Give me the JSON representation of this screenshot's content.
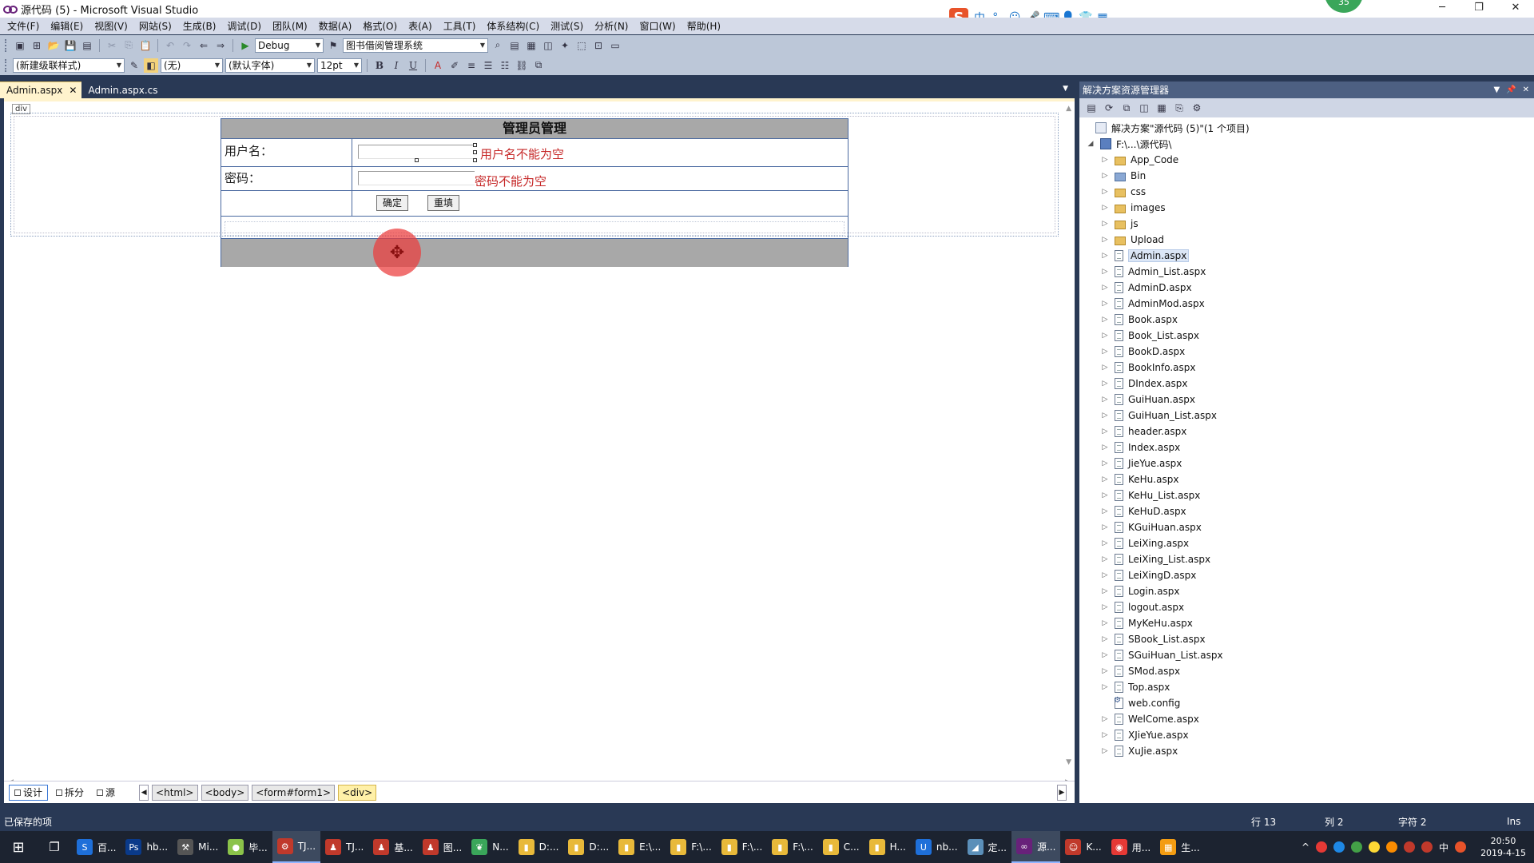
{
  "window": {
    "title": "源代码 (5) - Microsoft Visual Studio",
    "controls": [
      "─",
      "❐",
      "✕"
    ]
  },
  "ime": {
    "logo": "S",
    "items": [
      "中",
      "°,",
      "☺",
      "🎤",
      "⌨",
      "👤",
      "👕",
      "▦"
    ],
    "badge": "35"
  },
  "menu": [
    "文件(F)",
    "编辑(E)",
    "视图(V)",
    "网站(S)",
    "生成(B)",
    "调试(D)",
    "团队(M)",
    "数据(A)",
    "格式(O)",
    "表(A)",
    "工具(T)",
    "体系结构(C)",
    "测试(S)",
    "分析(N)",
    "窗口(W)",
    "帮助(H)"
  ],
  "toolbar1": {
    "config": "Debug",
    "project": "图书借阅管理系统"
  },
  "toolbar2": {
    "style": "(新建级联样式)",
    "block": "(无)",
    "font": "(默认字体)",
    "size": "12pt",
    "bold": "B",
    "italic": "I",
    "underline": "U"
  },
  "tabs": [
    {
      "label": "Admin.aspx",
      "close": "✕"
    },
    {
      "label": "Admin.aspx.cs"
    }
  ],
  "design": {
    "div_tag": "div",
    "table_title": "管理员管理",
    "username_label": "用户名：",
    "password_label": "密码：",
    "username_error": "用户名不能为空",
    "password_error": "密码不能为空",
    "ok_button": "确定",
    "reset_button": "重填",
    "move_glyph": "✥"
  },
  "views": [
    {
      "label": "设计"
    },
    {
      "label": "拆分"
    },
    {
      "label": "源"
    }
  ],
  "breadcrumb": [
    "<html>",
    "<body>",
    "<form#form1>",
    "<div>"
  ],
  "solution_explorer": {
    "title": "解决方案资源管理器",
    "solution": "解决方案\"源代码 (5)\"(1 个项目)",
    "project": "F:\\...\\源代码\\",
    "items": [
      {
        "name": "App_Code",
        "type": "folder"
      },
      {
        "name": "Bin",
        "type": "bin"
      },
      {
        "name": "css",
        "type": "folder"
      },
      {
        "name": "images",
        "type": "folder"
      },
      {
        "name": "js",
        "type": "folder"
      },
      {
        "name": "Upload",
        "type": "folder"
      },
      {
        "name": "Admin.aspx",
        "type": "file"
      },
      {
        "name": "Admin_List.aspx",
        "type": "file"
      },
      {
        "name": "AdminD.aspx",
        "type": "file"
      },
      {
        "name": "AdminMod.aspx",
        "type": "file"
      },
      {
        "name": "Book.aspx",
        "type": "file"
      },
      {
        "name": "Book_List.aspx",
        "type": "file"
      },
      {
        "name": "BookD.aspx",
        "type": "file"
      },
      {
        "name": "BookInfo.aspx",
        "type": "file"
      },
      {
        "name": "DIndex.aspx",
        "type": "file"
      },
      {
        "name": "GuiHuan.aspx",
        "type": "file"
      },
      {
        "name": "GuiHuan_List.aspx",
        "type": "file"
      },
      {
        "name": "header.aspx",
        "type": "file"
      },
      {
        "name": "Index.aspx",
        "type": "file"
      },
      {
        "name": "JieYue.aspx",
        "type": "file"
      },
      {
        "name": "KeHu.aspx",
        "type": "file"
      },
      {
        "name": "KeHu_List.aspx",
        "type": "file"
      },
      {
        "name": "KeHuD.aspx",
        "type": "file"
      },
      {
        "name": "KGuiHuan.aspx",
        "type": "file"
      },
      {
        "name": "LeiXing.aspx",
        "type": "file"
      },
      {
        "name": "LeiXing_List.aspx",
        "type": "file"
      },
      {
        "name": "LeiXingD.aspx",
        "type": "file"
      },
      {
        "name": "Login.aspx",
        "type": "file"
      },
      {
        "name": "logout.aspx",
        "type": "file"
      },
      {
        "name": "MyKeHu.aspx",
        "type": "file"
      },
      {
        "name": "SBook_List.aspx",
        "type": "file"
      },
      {
        "name": "SGuiHuan_List.aspx",
        "type": "file"
      },
      {
        "name": "SMod.aspx",
        "type": "file"
      },
      {
        "name": "Top.aspx",
        "type": "file"
      },
      {
        "name": "web.config",
        "type": "config"
      },
      {
        "name": "WelCome.aspx",
        "type": "file"
      },
      {
        "name": "XJieYue.aspx",
        "type": "file"
      },
      {
        "name": "XuJie.aspx",
        "type": "file"
      }
    ]
  },
  "status": {
    "message": "已保存的项",
    "row": "行 13",
    "col": "列 2",
    "char": "字符 2",
    "mode": "Ins"
  },
  "taskbar": {
    "apps": [
      {
        "label": "百...",
        "color": "#1e6fd9",
        "glyph": "S"
      },
      {
        "label": "hb...",
        "color": "#0a3a8a",
        "glyph": "Ps"
      },
      {
        "label": "Mi...",
        "color": "#555555",
        "glyph": "⚒"
      },
      {
        "label": "毕...",
        "color": "#8bc34a",
        "glyph": "●"
      },
      {
        "label": "TJ...",
        "color": "#c0392b",
        "glyph": "⚙"
      },
      {
        "label": "TJ...",
        "color": "#c0392b",
        "glyph": "♟"
      },
      {
        "label": "基...",
        "color": "#c0392b",
        "glyph": "♟"
      },
      {
        "label": "图...",
        "color": "#c0392b",
        "glyph": "♟"
      },
      {
        "label": "N...",
        "color": "#3aa65a",
        "glyph": "❦"
      },
      {
        "label": "D:...",
        "color": "#e8b93a",
        "glyph": "▮"
      },
      {
        "label": "D:...",
        "color": "#e8b93a",
        "glyph": "▮"
      },
      {
        "label": "E:\\...",
        "color": "#e8b93a",
        "glyph": "▮"
      },
      {
        "label": "F:\\...",
        "color": "#e8b93a",
        "glyph": "▮"
      },
      {
        "label": "F:\\...",
        "color": "#e8b93a",
        "glyph": "▮"
      },
      {
        "label": "F:\\...",
        "color": "#e8b93a",
        "glyph": "▮"
      },
      {
        "label": "C...",
        "color": "#e8b93a",
        "glyph": "▮"
      },
      {
        "label": "H...",
        "color": "#e8b93a",
        "glyph": "▮"
      },
      {
        "label": "nb...",
        "color": "#1e6fd9",
        "glyph": "U"
      },
      {
        "label": "定...",
        "color": "#5b8fb9",
        "glyph": "◢"
      },
      {
        "label": "源...",
        "color": "#68217a",
        "glyph": "∞"
      },
      {
        "label": "K...",
        "color": "#c0392b",
        "glyph": "☺"
      },
      {
        "label": "用...",
        "color": "#e53935",
        "glyph": "◉"
      },
      {
        "label": "生...",
        "color": "#f39c12",
        "glyph": "▦"
      }
    ],
    "ime": "中",
    "time": "20:50",
    "date": "2019-4-15"
  }
}
